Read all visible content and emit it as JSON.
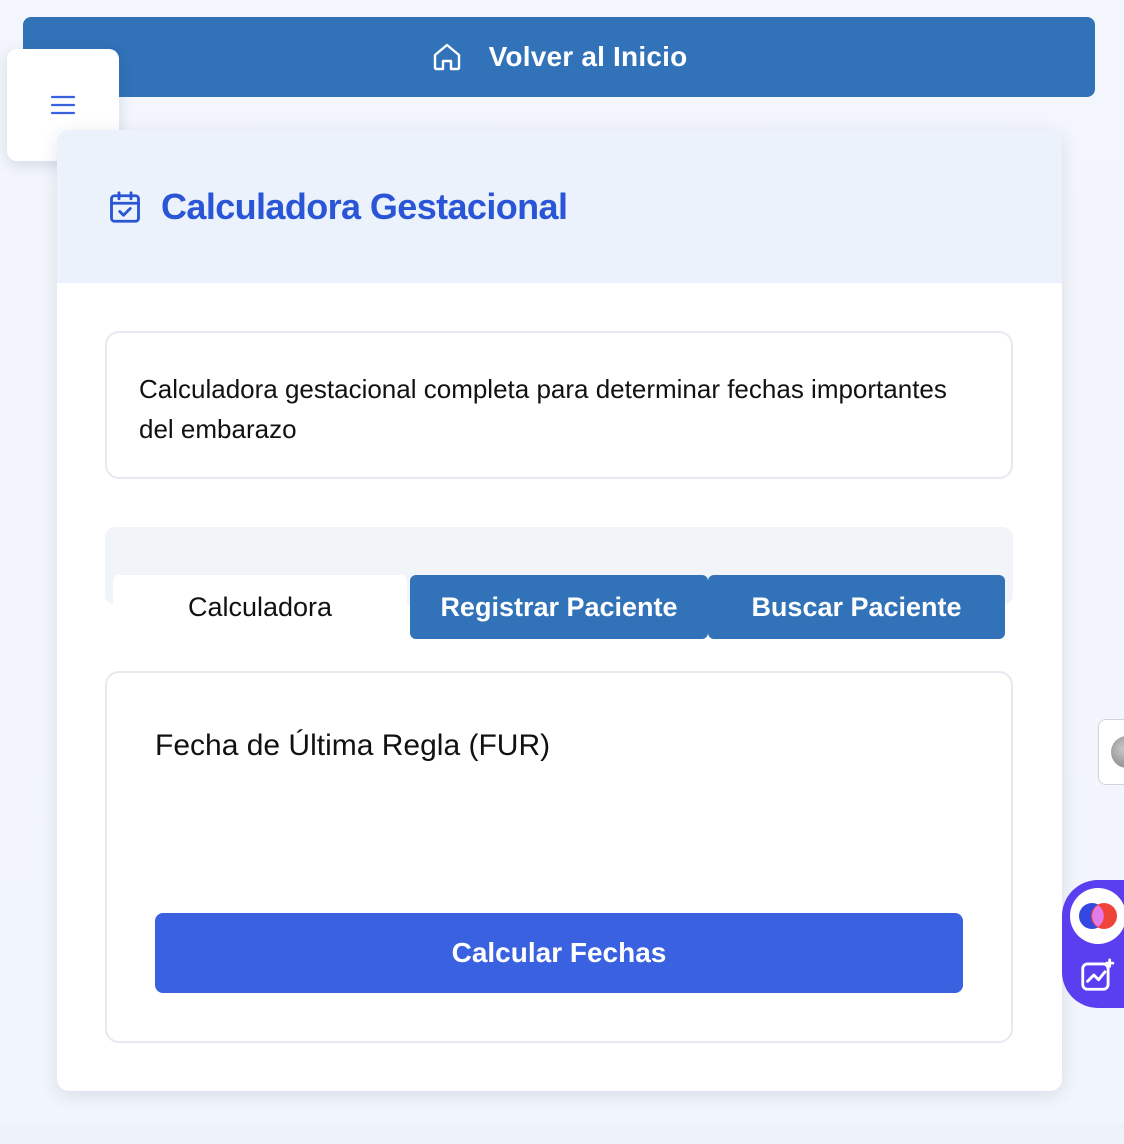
{
  "home_bar": {
    "label": "Volver al Inicio",
    "icon": "home-icon"
  },
  "menu": {
    "icon": "hamburger-menu-icon"
  },
  "header": {
    "title": "Calculadora Gestacional",
    "icon": "calendar-check-icon"
  },
  "description": "Calculadora gestacional completa para determinar fechas importantes del embarazo",
  "tabs": [
    {
      "label": "Calculadora",
      "active": true
    },
    {
      "label": "Registrar Paciente",
      "active": false
    },
    {
      "label": "Buscar Paciente",
      "active": false
    }
  ],
  "form": {
    "fur_label": "Fecha de Última Regla (FUR)",
    "submit_label": "Calcular Fechas"
  },
  "colors": {
    "primary_bar": "#3172b8",
    "accent_title": "#2a55d6",
    "submit_button": "#3a61e0",
    "header_bg": "#ebf2fb",
    "widget": "#5a3ff0"
  }
}
